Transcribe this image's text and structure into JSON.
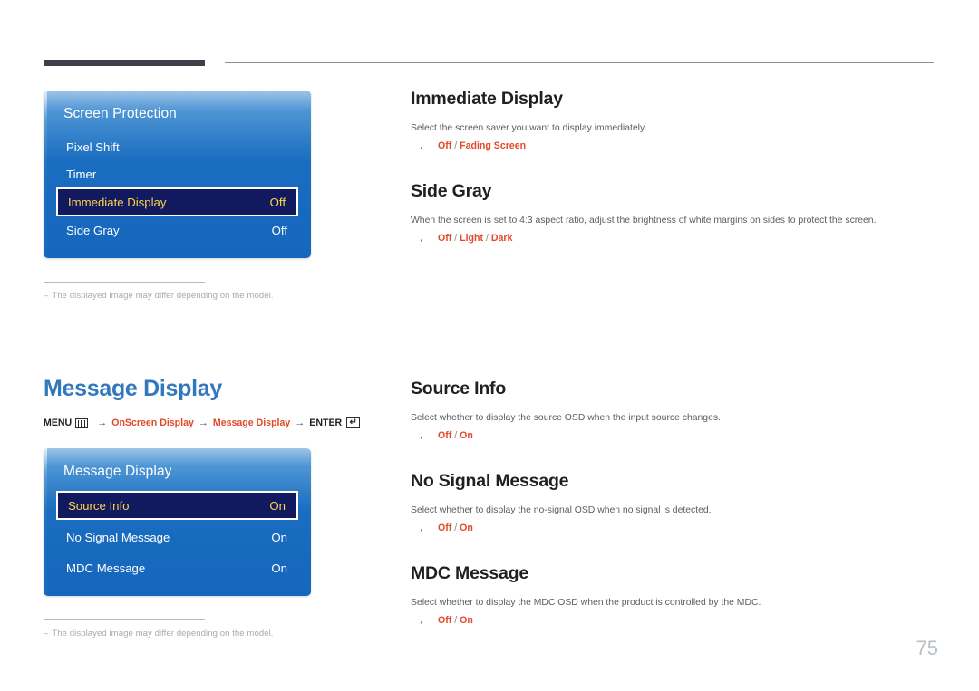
{
  "page": {
    "number": "75"
  },
  "section_screen_protection": {
    "osd": {
      "title": "Screen Protection",
      "rows": [
        {
          "label": "Pixel Shift",
          "value": "",
          "selected": false
        },
        {
          "label": "Timer",
          "value": "",
          "selected": false
        },
        {
          "label": "Immediate Display",
          "value": "Off",
          "selected": true
        },
        {
          "label": "Side Gray",
          "value": "Off",
          "selected": false
        }
      ]
    },
    "footnote": {
      "dash": "–",
      "text": "The displayed image may differ depending on the model."
    },
    "topics": [
      {
        "title": "Immediate Display",
        "description": "Select the screen saver you want to display immediately.",
        "options": [
          "Off",
          "Fading Screen"
        ]
      },
      {
        "title": "Side Gray",
        "description": "When the screen is set to 4:3 aspect ratio, adjust the brightness of white margins on sides to protect the screen.",
        "options": [
          "Off",
          "Light",
          "Dark"
        ]
      }
    ]
  },
  "section_message_display": {
    "heading": "Message Display",
    "breadcrumb": {
      "menu_label": "MENU",
      "menu_icon": "menu-grid-icon",
      "arrow": "→",
      "item1": "OnScreen Display",
      "item2": "Message Display",
      "enter_label": "ENTER",
      "enter_icon": "enter-key-icon",
      "enter_glyph": "↵"
    },
    "osd": {
      "title": "Message Display",
      "rows": [
        {
          "label": "Source Info",
          "value": "On",
          "selected": true
        },
        {
          "label": "No Signal Message",
          "value": "On",
          "selected": false
        },
        {
          "label": "MDC Message",
          "value": "On",
          "selected": false
        }
      ]
    },
    "footnote": {
      "dash": "–",
      "text": "The displayed image may differ depending on the model."
    },
    "topics": [
      {
        "title": "Source Info",
        "description": "Select whether to display the source OSD when the input source changes.",
        "options": [
          "Off",
          "On"
        ]
      },
      {
        "title": "No Signal Message",
        "description": "Select whether to display the no-signal OSD when no signal is detected.",
        "options": [
          "Off",
          "On"
        ]
      },
      {
        "title": "MDC Message",
        "description": "Select whether to display the MDC OSD when the product is controlled by the MDC.",
        "options": [
          "Off",
          "On"
        ]
      }
    ]
  },
  "colors": {
    "accent_blue": "#3178be",
    "option_red": "#e0492a",
    "osd_blue": "#1566bd",
    "osd_selected_bg": "#111a5e",
    "osd_selected_text": "#ffd34d",
    "page_number": "#b8bfc6"
  }
}
